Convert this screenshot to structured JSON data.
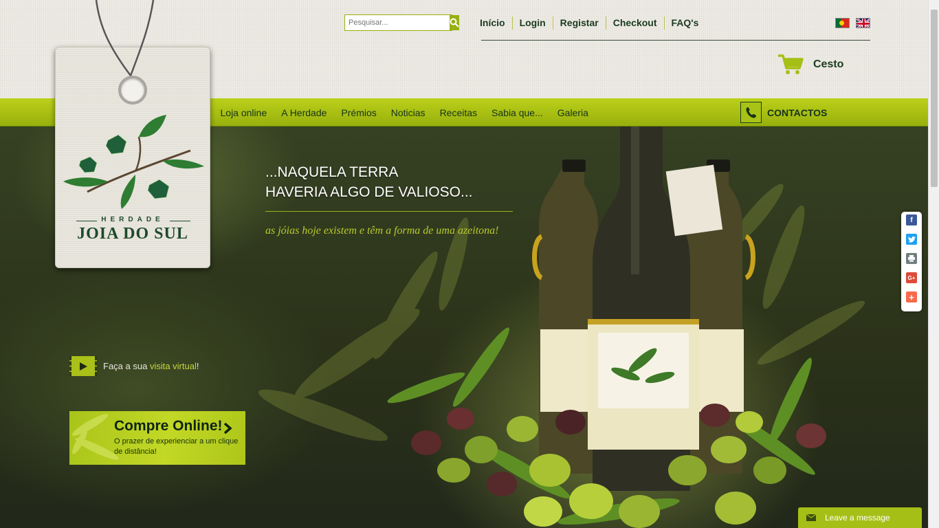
{
  "search": {
    "placeholder": "Pesquisar..."
  },
  "topnav": {
    "items": [
      "Início",
      "Login",
      "Registar",
      "Checkout",
      "FAQ's"
    ]
  },
  "cart": {
    "label": "Cesto"
  },
  "mainnav": {
    "items": [
      "Loja online",
      "A Herdade",
      "Prémios",
      "Noticias",
      "Receitas",
      "Sabia que...",
      "Galeria"
    ]
  },
  "contact": {
    "label": "CONTACTOS"
  },
  "logo": {
    "herdade": "HERDADE",
    "name": "JOIA DO SUL"
  },
  "hero": {
    "line1": "...NAQUELA TERRA",
    "line2": "HAVERIA ALGO DE VALIOSO...",
    "subtitle": "as jóias hoje existem e têm a forma de uma azeitona!"
  },
  "virtual": {
    "prefix": "Faça a sua ",
    "link": "visita virtual",
    "suffix": "!"
  },
  "compre": {
    "title": "Compre Online!",
    "desc": "O prazer de experienciar a um clique de distância!"
  },
  "chat": {
    "label": "Leave a message"
  },
  "colors": {
    "accent": "#a6bf17",
    "dark": "#1b3a21"
  },
  "icons": [
    "search-icon",
    "cart-icon",
    "phone-icon",
    "play-icon",
    "chevron-right-icon",
    "envelope-icon",
    "facebook-icon",
    "twitter-icon",
    "print-icon",
    "googleplus-icon",
    "plus-icon"
  ]
}
